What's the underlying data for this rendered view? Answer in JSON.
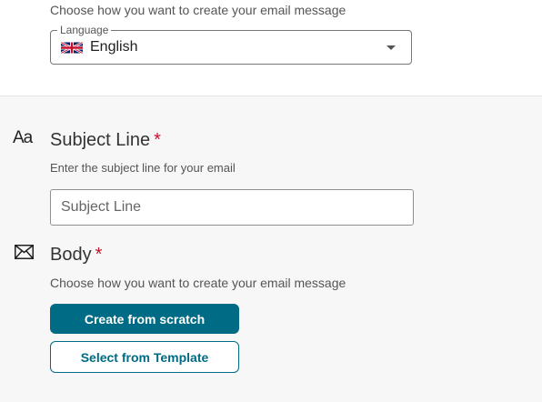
{
  "language_section": {
    "helper": "Choose how you want to create your email message",
    "field_label": "Language",
    "selected_value": "English",
    "flag_icon": "uk-flag-icon"
  },
  "subject_section": {
    "icon_glyph": "Aa",
    "title": "Subject Line",
    "required_mark": "*",
    "helper": "Enter the subject line for your email",
    "input_placeholder": "Subject Line",
    "input_value": ""
  },
  "body_section": {
    "icon": "envelope-icon",
    "title": "Body",
    "required_mark": "*",
    "helper": "Choose how you want to create your email message",
    "primary_button": "Create from scratch",
    "secondary_button": "Select from Template"
  },
  "colors": {
    "accent": "#006b84",
    "required": "#c8102e",
    "panel_background": "#f7f7f7"
  }
}
